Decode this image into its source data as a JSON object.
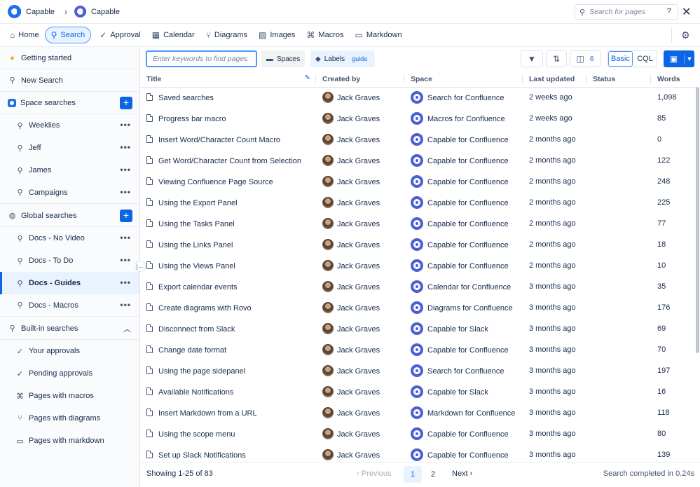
{
  "topbar": {
    "app_name": "Capable",
    "breadcrumb_app": "Capable",
    "search_placeholder": "Search for pages",
    "help_label": "?",
    "close_label": "✕"
  },
  "nav": {
    "items": [
      {
        "label": "Home",
        "icon": "home-icon"
      },
      {
        "label": "Search",
        "icon": "search-icon"
      },
      {
        "label": "Approval",
        "icon": "check-circle-icon"
      },
      {
        "label": "Calendar",
        "icon": "calendar-icon"
      },
      {
        "label": "Diagrams",
        "icon": "diagram-icon"
      },
      {
        "label": "Images",
        "icon": "image-icon"
      },
      {
        "label": "Macros",
        "icon": "macro-icon"
      },
      {
        "label": "Markdown",
        "icon": "markdown-icon"
      }
    ],
    "active": "Search"
  },
  "sidebar": {
    "getting_started": "Getting started",
    "new_search": "New Search",
    "space_searches": "Space searches",
    "space_items": [
      "Weeklies",
      "Jeff",
      "James",
      "Campaigns"
    ],
    "global_searches": "Global searches",
    "global_items": [
      "Docs - No Video",
      "Docs - To Do",
      "Docs - Guides",
      "Docs - Macros"
    ],
    "selected": "Docs - Guides",
    "builtin_searches": "Built-in searches",
    "builtin_items": [
      "Your approvals",
      "Pending approvals",
      "Pages with macros",
      "Pages with diagrams",
      "Pages with markdown"
    ],
    "more_label": "•••",
    "plus_label": "+"
  },
  "filters": {
    "keyword_placeholder": "Enter keywords to find pages",
    "spaces_label": "Spaces",
    "labels_label": "Labels",
    "label_tag": "guide",
    "columns_count": "6",
    "mode_basic": "Basic",
    "mode_cql": "CQL"
  },
  "table": {
    "columns": [
      "Title",
      "Created by",
      "Space",
      "Last updated",
      "Status",
      "Words"
    ],
    "rows": [
      {
        "title": "Saved searches",
        "author": "Jack Graves",
        "space": "Search for Confluence",
        "updated": "2 weeks ago",
        "status": "",
        "words": "1,098"
      },
      {
        "title": "Progress bar macro",
        "author": "Jack Graves",
        "space": "Macros for Confluence",
        "updated": "2 weeks ago",
        "status": "",
        "words": "85"
      },
      {
        "title": "Insert Word/Character Count Macro",
        "author": "Jack Graves",
        "space": "Capable for Confluence",
        "updated": "2 months ago",
        "status": "",
        "words": "0"
      },
      {
        "title": "Get Word/Character Count from Selection",
        "author": "Jack Graves",
        "space": "Capable for Confluence",
        "updated": "2 months ago",
        "status": "",
        "words": "122"
      },
      {
        "title": "Viewing Confluence Page Source",
        "author": "Jack Graves",
        "space": "Capable for Confluence",
        "updated": "2 months ago",
        "status": "",
        "words": "248"
      },
      {
        "title": "Using the Export Panel",
        "author": "Jack Graves",
        "space": "Capable for Confluence",
        "updated": "2 months ago",
        "status": "",
        "words": "225"
      },
      {
        "title": "Using the Tasks Panel",
        "author": "Jack Graves",
        "space": "Capable for Confluence",
        "updated": "2 months ago",
        "status": "",
        "words": "77"
      },
      {
        "title": "Using the Links Panel",
        "author": "Jack Graves",
        "space": "Capable for Confluence",
        "updated": "2 months ago",
        "status": "",
        "words": "18"
      },
      {
        "title": "Using the Views Panel",
        "author": "Jack Graves",
        "space": "Capable for Confluence",
        "updated": "2 months ago",
        "status": "",
        "words": "10"
      },
      {
        "title": "Export calendar events",
        "author": "Jack Graves",
        "space": "Calendar for Confluence",
        "updated": "3 months ago",
        "status": "",
        "words": "35"
      },
      {
        "title": "Create diagrams with Rovo",
        "author": "Jack Graves",
        "space": "Diagrams for Confluence",
        "updated": "3 months ago",
        "status": "",
        "words": "176"
      },
      {
        "title": "Disconnect from Slack",
        "author": "Jack Graves",
        "space": "Capable for Slack",
        "updated": "3 months ago",
        "status": "",
        "words": "69"
      },
      {
        "title": "Change date format",
        "author": "Jack Graves",
        "space": "Capable for Confluence",
        "updated": "3 months ago",
        "status": "",
        "words": "70"
      },
      {
        "title": "Using the page sidepanel",
        "author": "Jack Graves",
        "space": "Search for Confluence",
        "updated": "3 months ago",
        "status": "",
        "words": "197"
      },
      {
        "title": "Available Notifications",
        "author": "Jack Graves",
        "space": "Capable for Slack",
        "updated": "3 months ago",
        "status": "",
        "words": "16"
      },
      {
        "title": "Insert Markdown from a URL",
        "author": "Jack Graves",
        "space": "Markdown for Confluence",
        "updated": "3 months ago",
        "status": "",
        "words": "118"
      },
      {
        "title": "Using the scope menu",
        "author": "Jack Graves",
        "space": "Capable for Confluence",
        "updated": "3 months ago",
        "status": "",
        "words": "80"
      },
      {
        "title": "Set up Slack Notifications",
        "author": "Jack Graves",
        "space": "Capable for Confluence",
        "updated": "3 months ago",
        "status": "",
        "words": "139"
      }
    ]
  },
  "footer": {
    "showing": "Showing 1-25 of 83",
    "previous": "Previous",
    "pages": [
      "1",
      "2"
    ],
    "next": "Next",
    "completed": "Search completed in 0.24s"
  },
  "colors": {
    "accent": "#0c66e4",
    "space_logo": "#4d5fd6"
  }
}
